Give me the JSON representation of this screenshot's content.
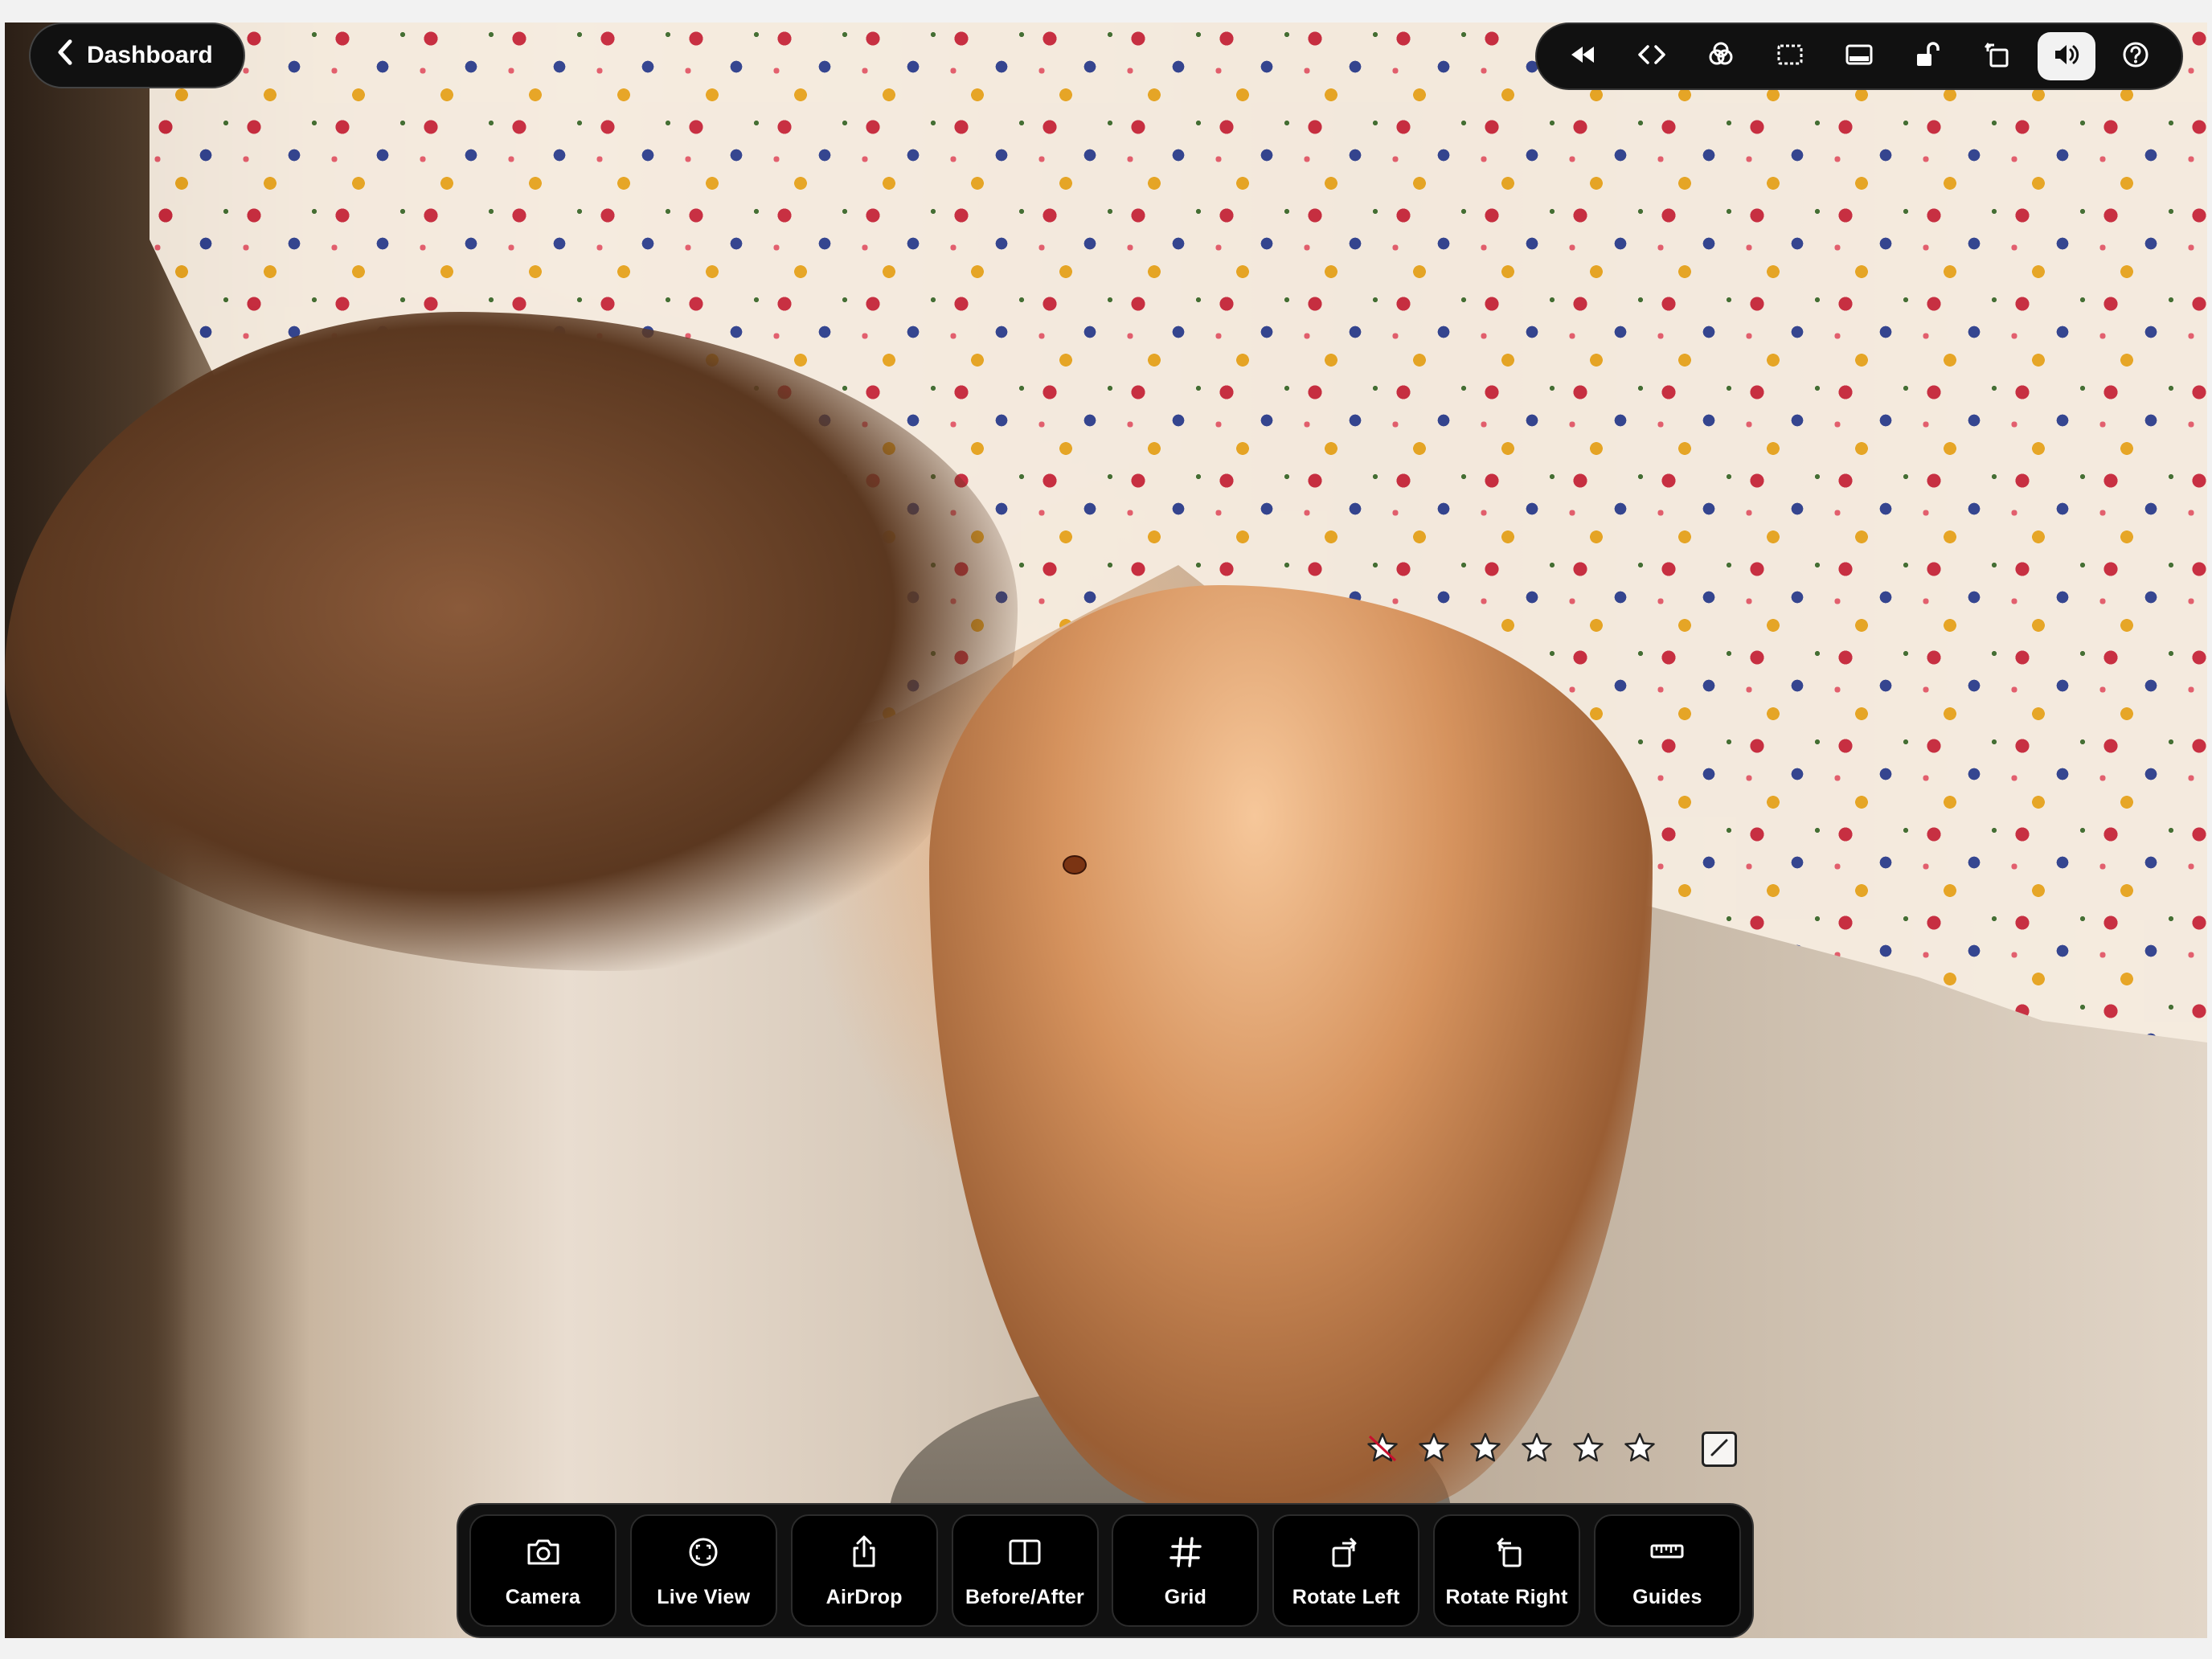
{
  "nav": {
    "back_label": "Dashboard"
  },
  "top_tools": [
    {
      "name": "rewind-icon"
    },
    {
      "name": "code-icon"
    },
    {
      "name": "color-filter-icon"
    },
    {
      "name": "crop-icon"
    },
    {
      "name": "panel-icon"
    },
    {
      "name": "unlock-icon"
    },
    {
      "name": "rotate-icon"
    },
    {
      "name": "speaker-icon",
      "active": true
    },
    {
      "name": "help-icon"
    }
  ],
  "rating": {
    "stars_total": 5,
    "reject_marked": true
  },
  "toolbar": {
    "camera": "Camera",
    "live_view": "Live View",
    "airdrop": "AirDrop",
    "before_after": "Before/After",
    "grid": "Grid",
    "rotate_left": "Rotate Left",
    "rotate_right": "Rotate Right",
    "guides": "Guides"
  },
  "colors": {
    "bar_bg": "#111111",
    "active_bg": "#f2f2f2",
    "reject_red": "#c8102e"
  }
}
